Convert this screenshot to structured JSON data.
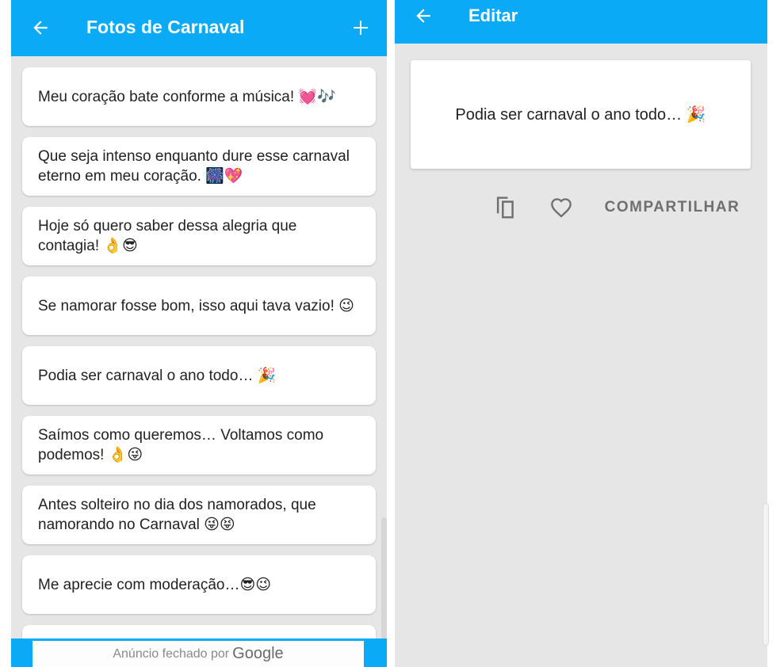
{
  "left_screen": {
    "title": "Fotos de Carnaval",
    "back_icon": "arrow-left-icon",
    "add_icon": "plus-icon",
    "phrases": [
      {
        "text": "Meu coração bate conforme a música! 💓🎶"
      },
      {
        "text": "Que seja intenso enquanto dure esse carnaval eterno em meu coração. 🎆💖"
      },
      {
        "text": "Hoje só quero saber dessa alegria que contagia! 👌😎"
      },
      {
        "text": "Se namorar fosse bom, isso aqui tava vazio! 😉"
      },
      {
        "text": "Podia ser carnaval o ano todo… 🎉"
      },
      {
        "text": "Saímos como queremos… Voltamos como podemos! 👌😜"
      },
      {
        "text": "Antes solteiro no dia dos namorados, que namorando no Carnaval 😜😝"
      },
      {
        "text": "Me aprecie com moderação…😎😉"
      }
    ],
    "ad": {
      "text": "Anúncio fechado por",
      "brand": "Google"
    }
  },
  "right_screen": {
    "title": "Editar",
    "back_icon": "arrow-left-icon",
    "edit_text": "Podia ser carnaval o ano todo… 🎉",
    "actions": {
      "copy_icon": "copy-icon",
      "favorite_icon": "heart-outline-icon",
      "share_label": "COMPARTILHAR"
    }
  },
  "colors": {
    "app_bar": "#0aaaf6",
    "background": "#e6e6e6",
    "card": "#ffffff",
    "action_gray": "#6f6f6f"
  }
}
